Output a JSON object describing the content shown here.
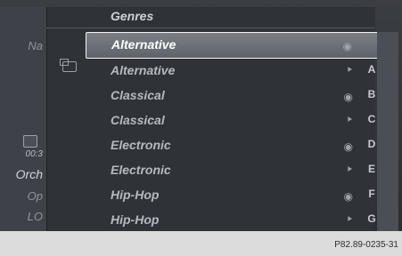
{
  "header": {
    "title": "Genres"
  },
  "left": {
    "label_na": "Na",
    "time": "00:3",
    "orch": "Orch",
    "op": "Op",
    "lo": "LO"
  },
  "rows": [
    {
      "label": "Alternative",
      "letter": "",
      "icon": "disc-cd-icon"
    },
    {
      "label": "Alternative",
      "letter": "A",
      "icon": "file-icon"
    },
    {
      "label": "Classical",
      "letter": "B",
      "icon": "disc-cd-icon"
    },
    {
      "label": "Classical",
      "letter": "C",
      "icon": "file-icon"
    },
    {
      "label": "Electronic",
      "letter": "D",
      "icon": "disc-cd-icon"
    },
    {
      "label": "Electronic",
      "letter": "E",
      "icon": "file-icon"
    },
    {
      "label": "Hip-Hop",
      "letter": "F",
      "icon": "disc-cd-icon"
    },
    {
      "label": "Hip-Hop",
      "letter": "G",
      "icon": "file-icon"
    }
  ],
  "footer": {
    "ref": "P82.89-0235-31"
  }
}
